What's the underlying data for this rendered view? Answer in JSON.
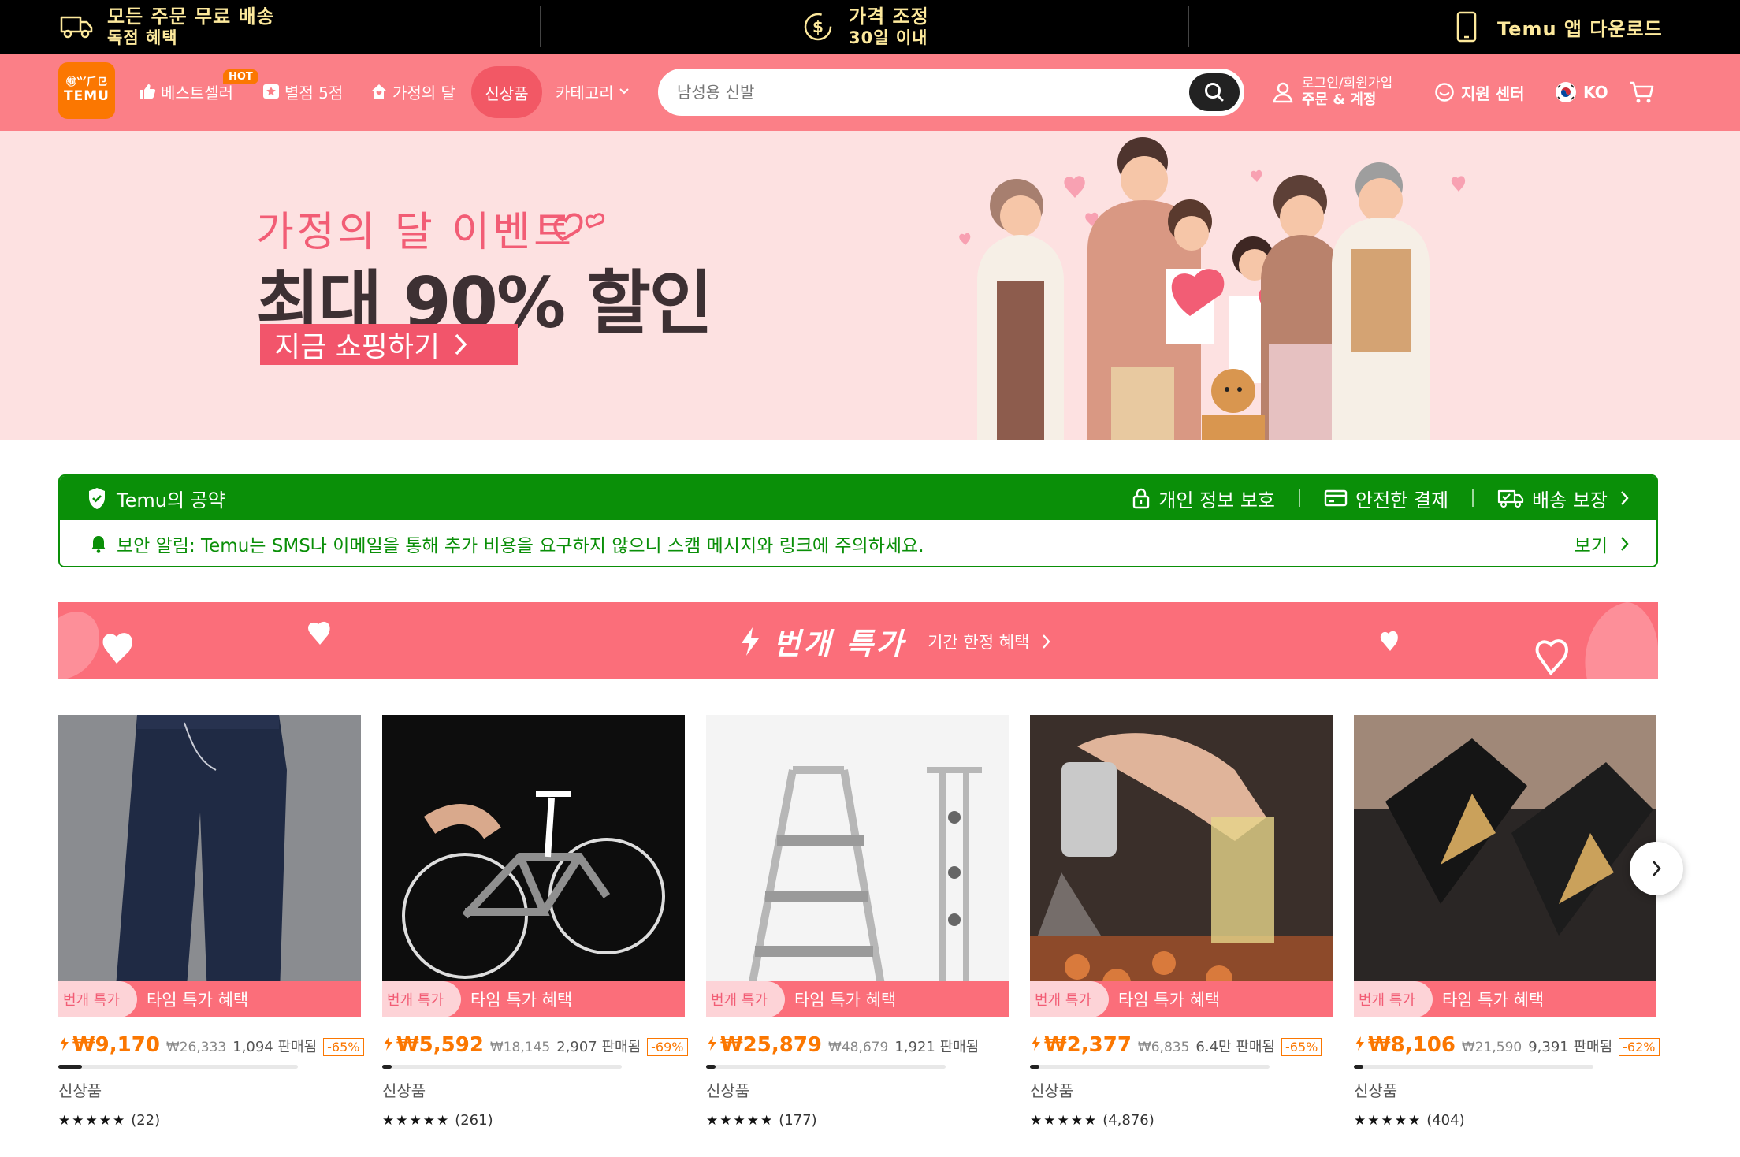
{
  "topbar": {
    "shipping_line1": "모든 주문 무료 배송",
    "shipping_line2": "독점 혜택",
    "price_line1": "가격 조정",
    "price_line2": "30일 이내",
    "app_download": "Temu 앱 다운로드"
  },
  "header": {
    "logo_top": "㉼⺍⺁⺋",
    "logo_bottom": "TEMU",
    "nav": {
      "bestseller": "베스트셀러",
      "hot_badge": "HOT",
      "five_star": "별점 5점",
      "family_month": "가정의 달",
      "new_arrivals": "신상품",
      "category": "카테고리"
    },
    "search_placeholder": "남성용 신발",
    "account_line1": "로그인/회원가입",
    "account_line2": "주문 & 계정",
    "support": "지원 센터",
    "language": "KO"
  },
  "banner": {
    "event_title": "가정의 달 이벤트",
    "headline": "최대 90% 할인",
    "cta": "지금 쇼핑하기"
  },
  "commitment": {
    "title": "Temu의 공약",
    "privacy": "개인 정보 보호",
    "payment": "안전한 결제",
    "delivery": "배송 보장",
    "alert": "보안 알림: Temu는 SMS나 이메일을 통해 추가 비용을 요구하지 않으니 스캠 메시지와 링크에 주의하세요.",
    "view": "보기"
  },
  "deals": {
    "title": "번개 특가",
    "subtitle": "기간 한정 혜택"
  },
  "products": [
    {
      "flash_a": "번개 특가",
      "flash_b": "타임 특가 혜택",
      "price": "₩9,170",
      "original": "₩26,333",
      "sold": "1,094 판매됨",
      "discount": "-65%",
      "progress": 0.1,
      "tag": "신상품",
      "stars": "★★★★★",
      "reviews": "(22)"
    },
    {
      "flash_a": "번개 특가",
      "flash_b": "타임 특가 혜택",
      "price": "₩5,592",
      "original": "₩18,145",
      "sold": "2,907 판매됨",
      "discount": "-69%",
      "progress": 0.04,
      "tag": "신상품",
      "stars": "★★★★★",
      "reviews": "(261)"
    },
    {
      "flash_a": "번개 특가",
      "flash_b": "타임 특가 혜택",
      "price": "₩25,879",
      "original": "₩48,679",
      "sold": "1,921 판매됨",
      "discount": "",
      "progress": 0.04,
      "tag": "신상품",
      "stars": "★★★★★",
      "reviews": "(177)"
    },
    {
      "flash_a": "번개 특가",
      "flash_b": "타임 특가 혜택",
      "price": "₩2,377",
      "original": "₩6,835",
      "sold": "6.4만 판매됨",
      "discount": "-65%",
      "progress": 0.04,
      "tag": "신상품",
      "stars": "★★★★★",
      "reviews": "(4,876)"
    },
    {
      "flash_a": "번개 특가",
      "flash_b": "타임 특가 혜택",
      "price": "₩8,106",
      "original": "₩21,590",
      "sold": "9,391 판매됨",
      "discount": "-62%",
      "progress": 0.04,
      "tag": "신상품",
      "stars": "★★★★★",
      "reviews": "(404)"
    }
  ],
  "colors": {
    "brand_orange": "#fb7701",
    "header_pink": "#fb7f87",
    "commitment_green": "#0a8f08",
    "deal_pink": "#fb6e7a"
  }
}
